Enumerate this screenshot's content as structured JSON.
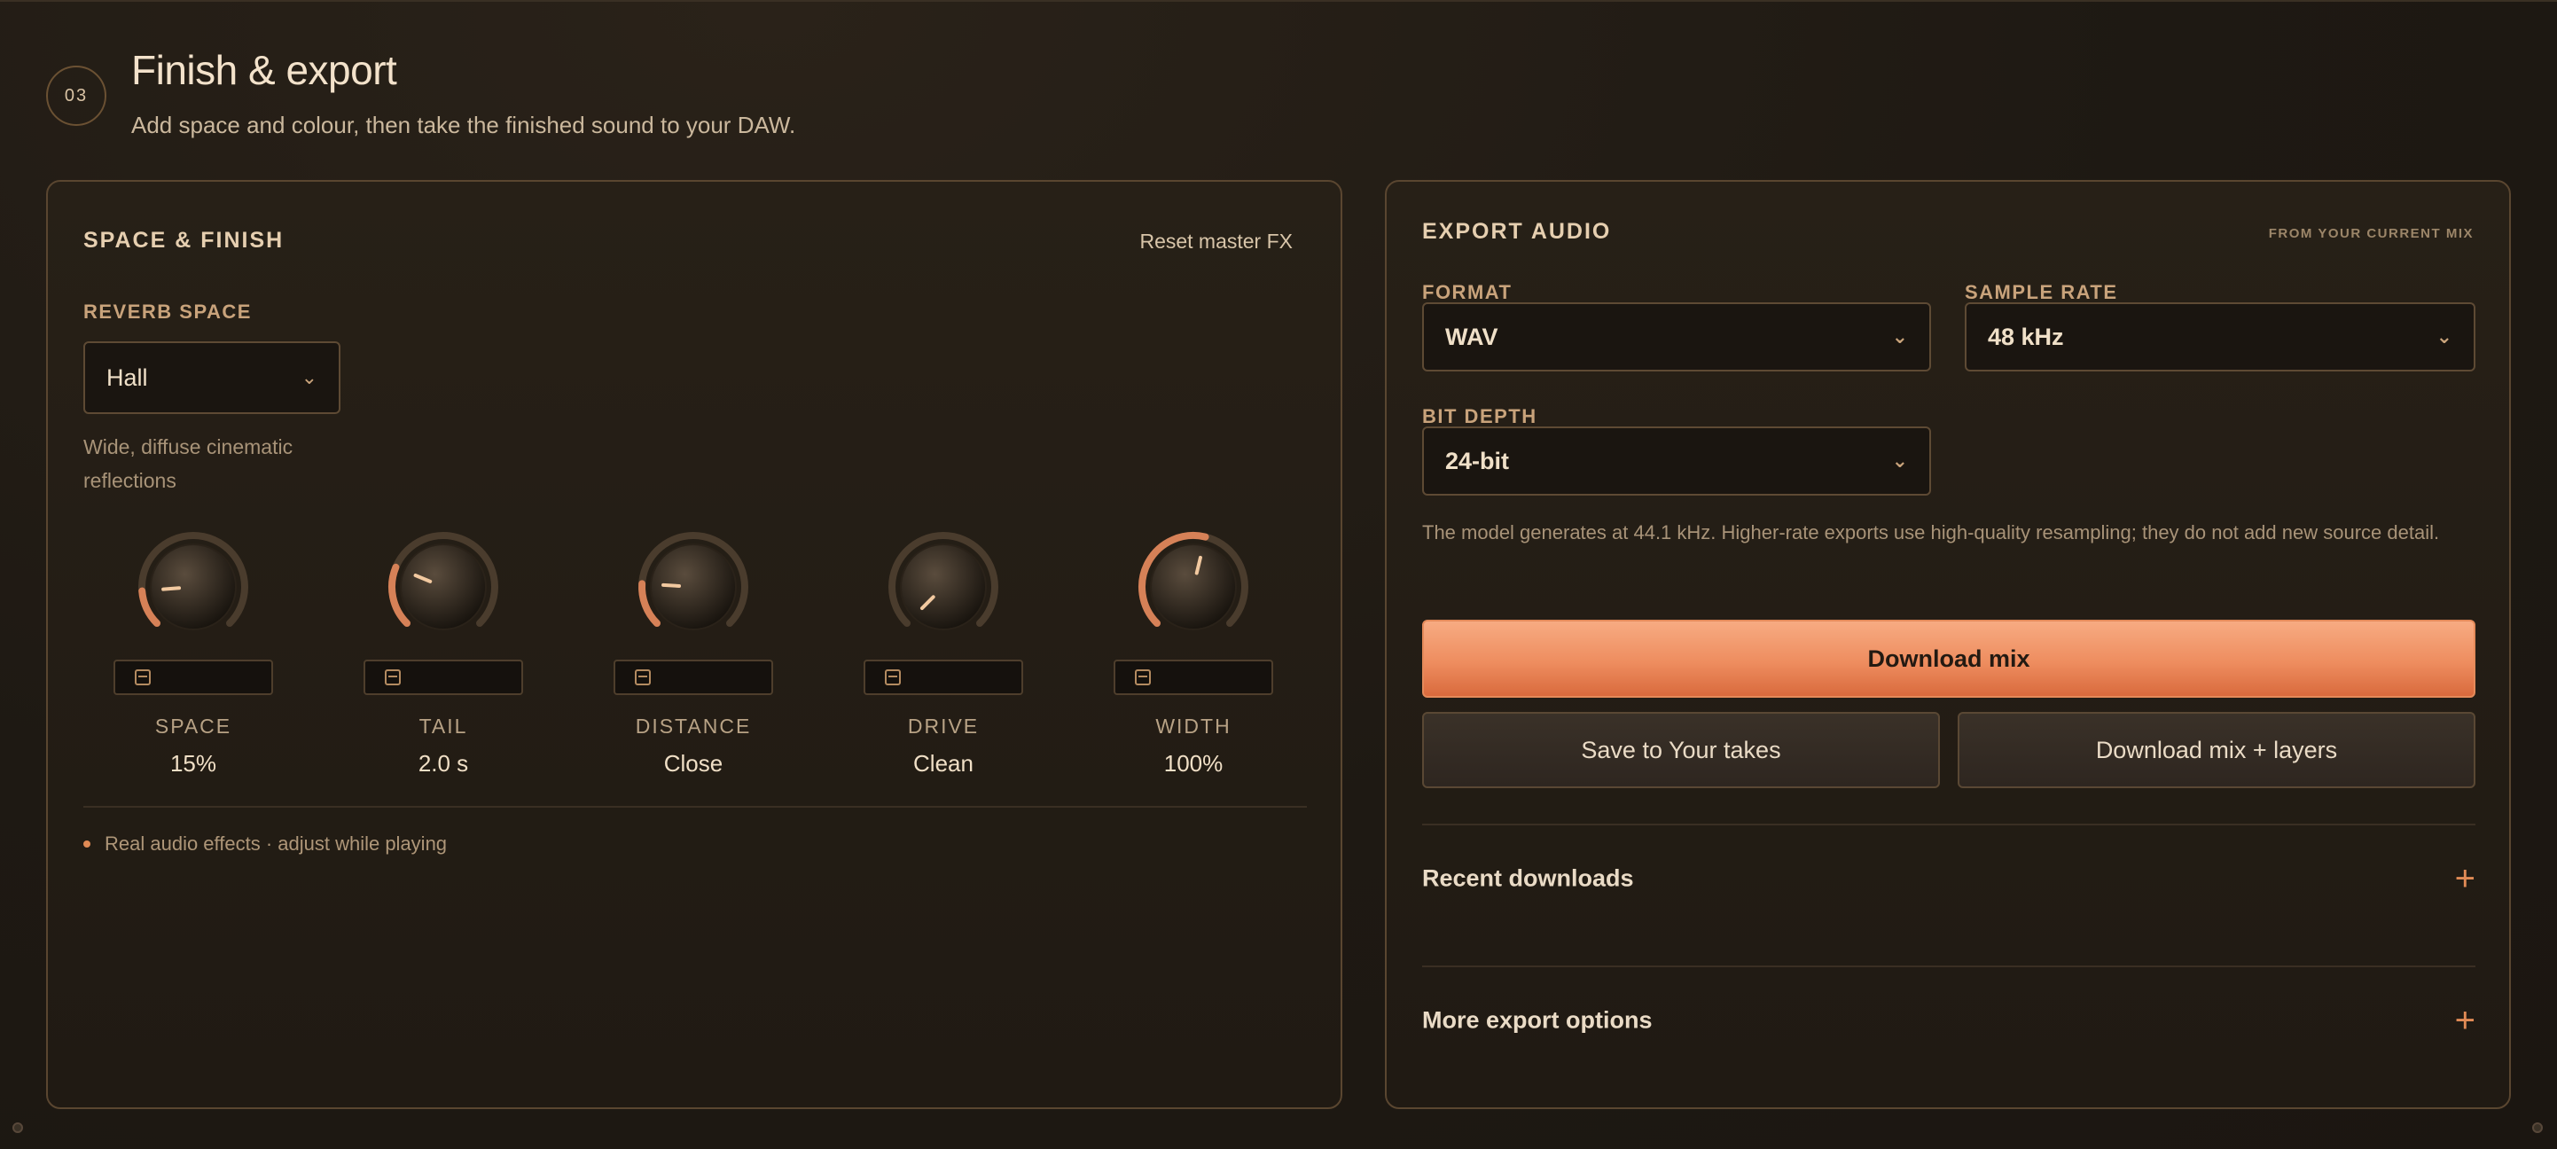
{
  "header": {
    "step": "03",
    "title": "Finish & export",
    "subtitle": "Add space and colour, then take the finished sound to your DAW."
  },
  "space_finish": {
    "heading": "SPACE & FINISH",
    "reset_label": "Reset master FX",
    "reverb_label": "REVERB SPACE",
    "reverb_value": "Hall",
    "reverb_description": "Wide, diffuse cinematic reflections",
    "knobs": [
      {
        "label": "SPACE",
        "value": "15%",
        "level": 0.15
      },
      {
        "label": "TAIL",
        "value": "2.0 s",
        "level": 0.25
      },
      {
        "label": "DISTANCE",
        "value": "Close",
        "level": 0.18
      },
      {
        "label": "DRIVE",
        "value": "Clean",
        "level": 0.0
      },
      {
        "label": "WIDTH",
        "value": "100%",
        "level": 0.55
      }
    ],
    "note": "Real audio effects · adjust while playing"
  },
  "export_audio": {
    "heading": "EXPORT AUDIO",
    "meta": "FROM YOUR CURRENT MIX",
    "format_label": "FORMAT",
    "format_value": "WAV",
    "sample_rate_label": "SAMPLE RATE",
    "sample_rate_value": "48 kHz",
    "bit_depth_label": "BIT DEPTH",
    "bit_depth_value": "24-bit",
    "info": "The model generates at 44.1 kHz. Higher-rate exports use high-quality resampling; they do not add new source detail.",
    "download_mix": "Download mix",
    "save_takes": "Save to Your takes",
    "download_layers": "Download mix + layers",
    "recent_downloads": "Recent downloads",
    "more_options": "More export options"
  },
  "colors": {
    "accent": "#ee8d5f",
    "panel_border": "#5a4630",
    "background": "#1e1913"
  }
}
